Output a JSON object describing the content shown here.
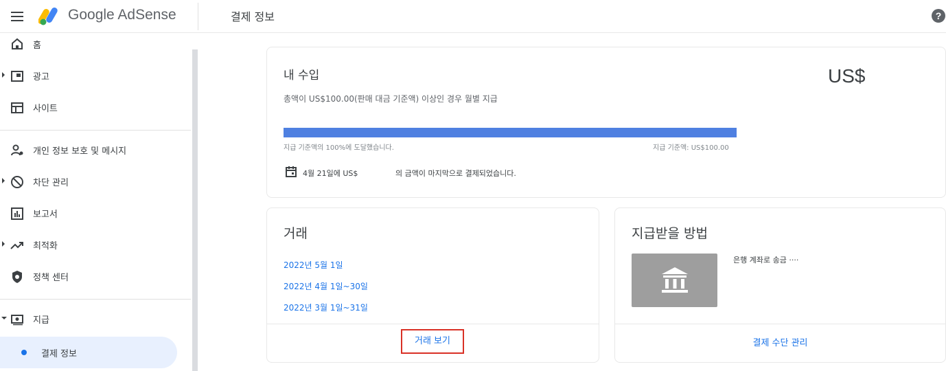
{
  "header": {
    "brand": "Google AdSense",
    "page_title": "결제 정보",
    "help_glyph": "?"
  },
  "sidebar": {
    "items": [
      {
        "label": "홈",
        "icon": "home-icon"
      },
      {
        "label": "광고",
        "icon": "ads-icon"
      },
      {
        "label": "사이트",
        "icon": "sites-icon"
      },
      {
        "label": "개인 정보 보호 및 메시지",
        "icon": "privacy-icon"
      },
      {
        "label": "차단 관리",
        "icon": "block-icon"
      },
      {
        "label": "보고서",
        "icon": "reports-icon"
      },
      {
        "label": "최적화",
        "icon": "optimize-icon"
      },
      {
        "label": "정책 센터",
        "icon": "policy-icon"
      },
      {
        "label": "지급",
        "icon": "payments-icon"
      }
    ],
    "subitem": {
      "label": "결제 정보"
    }
  },
  "earnings": {
    "title": "내 수입",
    "amount": "US$",
    "description": "총액이 US$100.00(판매 대금 기준액) 이상인 경우 월별 지급",
    "progress_percent": 100,
    "progress_left_label": "지급 기준액의 100%에 도달했습니다.",
    "progress_right_label": "지급 기준액: US$100.00",
    "last_payment_a": "4월 21일에 US$",
    "last_payment_b": "의 금액이 마지막으로 결제되었습니다."
  },
  "transactions": {
    "title": "거래",
    "links": [
      "2022년 5월 1일",
      "2022년 4월 1일~30일",
      "2022년 3월 1일~31일"
    ],
    "view_button": "거래 보기"
  },
  "payment_method": {
    "title": "지급받을 방법",
    "bank_text": "은행 계좌로 송금 ····",
    "manage_button": "결제 수단 관리"
  },
  "colors": {
    "accent": "#1a73e8",
    "progress": "#4f80e1",
    "highlight_border": "#d93025"
  }
}
